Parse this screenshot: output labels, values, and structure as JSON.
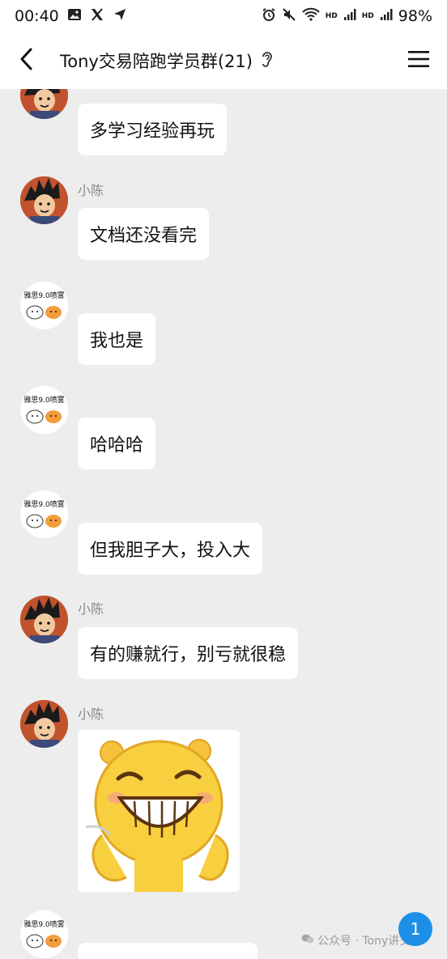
{
  "status_bar": {
    "time": "00:40",
    "battery": "98%",
    "hd1": "HD",
    "hd2": "HD",
    "left_icons": [
      "image-icon",
      "x-icon",
      "send-icon"
    ],
    "right_icons": [
      "alarm-icon",
      "mute-icon",
      "wifi-icon",
      "signal-icon",
      "signal-icon"
    ]
  },
  "header": {
    "title": "Tony交易陪跑学员群(21)",
    "back_icon": "chevron-left-icon",
    "ear_icon": "ear-icon",
    "menu_icon": "menu-icon"
  },
  "messages": [
    {
      "sender": "",
      "avatar": "goku",
      "text": "多学习经验再玩"
    },
    {
      "sender": "小陈",
      "avatar": "goku",
      "text": "文档还没看完"
    },
    {
      "sender": "",
      "avatar": "sticker-avatar",
      "avatar_caption": "雅思9.0喷雾",
      "text": "我也是"
    },
    {
      "sender": "",
      "avatar": "sticker-avatar",
      "avatar_caption": "雅思9.0喷雾",
      "text": "哈哈哈"
    },
    {
      "sender": "",
      "avatar": "sticker-avatar",
      "avatar_caption": "雅思9.0喷雾",
      "text": "但我胆子大，投入大"
    },
    {
      "sender": "小陈",
      "avatar": "goku",
      "text": "有的赚就行，别亏就很稳"
    },
    {
      "sender": "小陈",
      "avatar": "goku",
      "text": "",
      "sticker": "laughing-face"
    },
    {
      "sender": "",
      "avatar": "sticker-avatar",
      "avatar_caption": "雅思9.0喷雾",
      "text": ""
    }
  ],
  "watermark": "公众号 · Tony讲交易",
  "unread_count": "1",
  "colors": {
    "background": "#ededed",
    "bubble": "#ffffff",
    "unread_badge": "#1e8fe6"
  }
}
